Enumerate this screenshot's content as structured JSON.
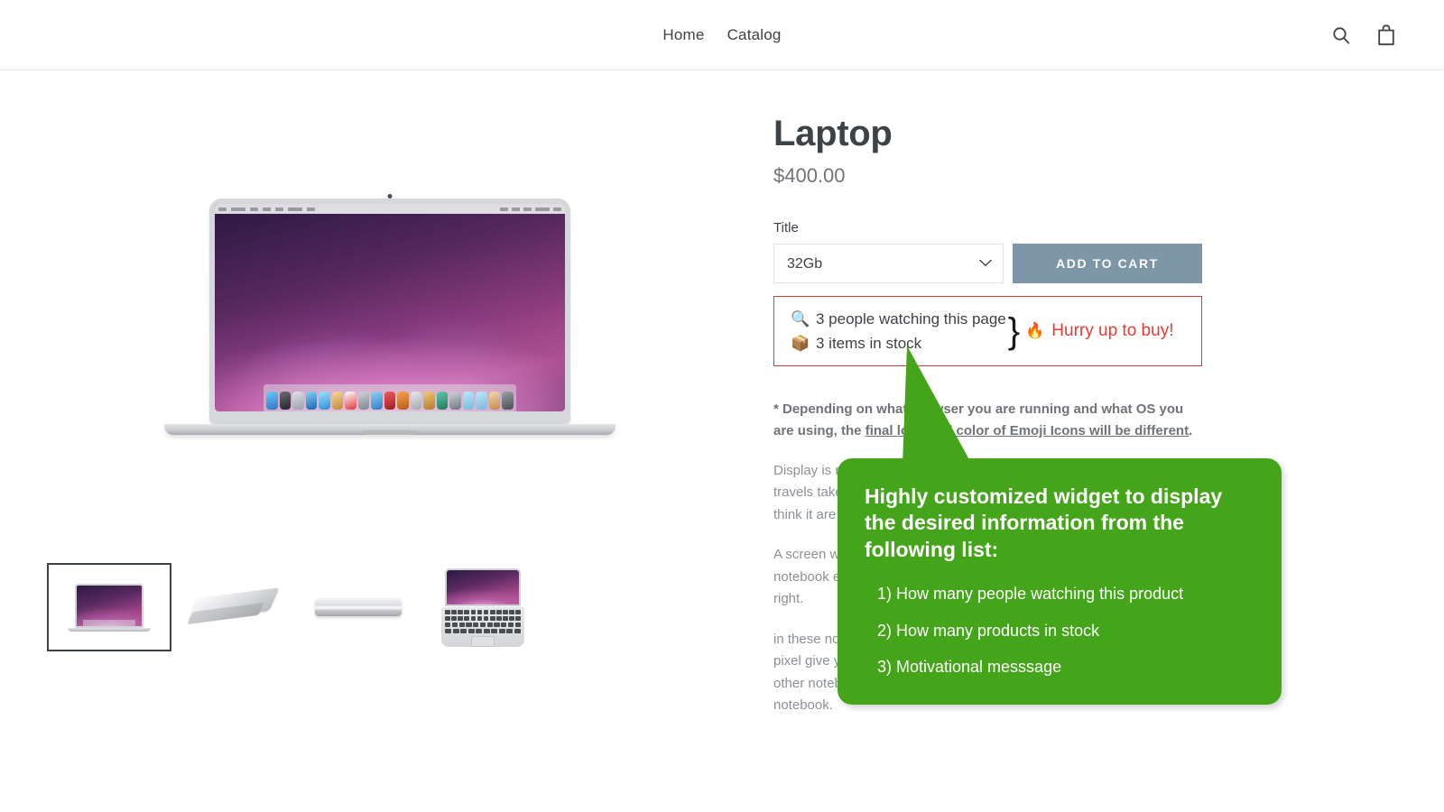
{
  "header": {
    "nav": [
      {
        "label": "Home",
        "name": "nav-link-home"
      },
      {
        "label": "Catalog",
        "name": "nav-link-catalog"
      }
    ],
    "icons": {
      "search": "search-icon",
      "cart": "shopping-bag-icon"
    }
  },
  "product": {
    "title": "Laptop",
    "price": "$400.00",
    "option_label": "Title",
    "variant_selected": "32Gb",
    "variant_options": [
      "32Gb"
    ],
    "add_to_cart_label": "ADD TO CART",
    "thumbnails": [
      {
        "name": "thumbnail-front-open",
        "selected": true
      },
      {
        "name": "thumbnail-angled-closed",
        "selected": false
      },
      {
        "name": "thumbnail-side-closed",
        "selected": false
      },
      {
        "name": "thumbnail-top-open",
        "selected": false
      }
    ]
  },
  "urgency_widget": {
    "border_color": "#d93b3b",
    "watching_icon": "magnifying-glass-emoji",
    "watching_text": "3 people watching this page",
    "stock_icon": "package-emoji",
    "stock_text": "3 items in stock",
    "brace": "}",
    "message_icon": "fire-emoji",
    "message_text": "Hurry up to buy!",
    "message_color": "#ea3a30"
  },
  "description": {
    "note_prefix": "* Depending on what browser you are running and what OS you are using, the ",
    "note_underlined": "final look and color of Emoji Icons will be different",
    "note_suffix": ".",
    "paragraphs": [
      "Display is ready to take on whatever you can dream up, wherever you travels take you. Retina display. Outstanding. Its pixels for notebook, I think it are world’s highest.",
      "A screen where everything is perfectly pitched. Has fabulous display in notebook ever. The pixel density than any other notebook in its own right.",
      "in these notebooks. If you are editing a home movie in HD all those pixel give your image a level of clarity. You have never seen on any other notebook ever. It’s display worthy of the world’s most advance notebook."
    ]
  },
  "callout": {
    "background_color": "#45a51a",
    "title": "Highly customized widget to display the desired information from the following list:",
    "items": [
      "1) How many people watching this product",
      "2) How many products in stock",
      "3) Motivational messsage"
    ]
  }
}
